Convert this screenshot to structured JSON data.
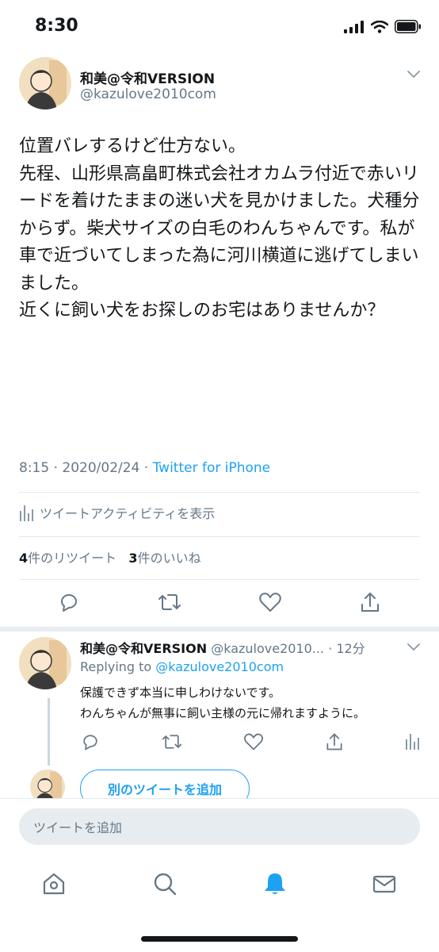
{
  "status_bar": {
    "time": "8:30"
  },
  "tweet": {
    "display_name": "和美@令和VERSION",
    "handle": "@kazulove2010com",
    "body": "位置バレするけど仕方ない。\n先程、山形県高畠町株式会社オカムラ付近で赤いリードを着けたままの迷い犬を見かけました。犬種分からず。柴犬サイズの白毛のわんちゃんです。私が車で近づいてしまった為に河川横道に逃げてしまいました。\n近くに飼い犬をお探しのお宅はありませんか？",
    "time": "8:15 · 2020/02/24 · ",
    "source": "Twitter for iPhone",
    "activity_label": "ツイートアクティビティを表示",
    "retweet_count": "4",
    "retweet_label": "件のリツイート",
    "like_count": "3",
    "like_label": "件のいいね"
  },
  "reply": {
    "display_name": "和美@令和VERSION",
    "handle_time": "@kazulove2010... · 12分",
    "replying_prefix": "Replying to ",
    "replying_to": "@kazulove2010com",
    "body": "保護できず本当に申しわけないです。\nわんちゃんが無事に飼い主様の元に帰れますように。"
  },
  "add_tweet_button": "別のツイートを追加",
  "compose": {
    "placeholder": "ツイートを追加"
  },
  "colors": {
    "accent": "#1da1f2",
    "muted": "#657786",
    "text": "#14171a",
    "divider": "#e1e8ed"
  },
  "icons": [
    "signal-icon",
    "wifi-icon",
    "battery-icon",
    "chevron-down-icon",
    "activity-icon",
    "reply-icon",
    "retweet-icon",
    "like-icon",
    "share-icon",
    "home-icon",
    "search-icon",
    "notifications-icon",
    "messages-icon"
  ]
}
